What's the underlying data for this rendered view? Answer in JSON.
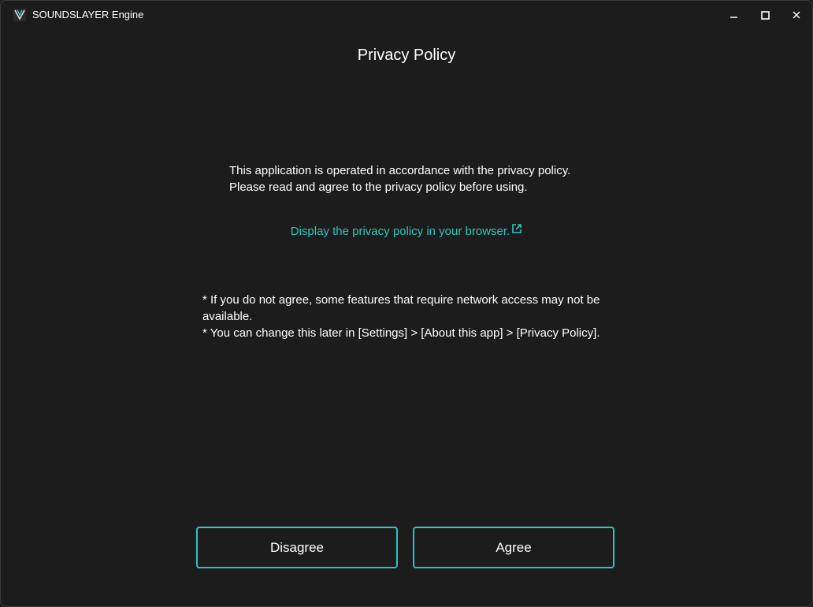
{
  "window": {
    "title": "SOUNDSLAYER Engine",
    "icon": "app-logo-icon",
    "controls": {
      "minimize": "minimize-icon",
      "maximize": "maximize-icon",
      "close": "close-icon"
    }
  },
  "dialog": {
    "heading": "Privacy Policy",
    "intro_line1": "This application is operated in accordance with the privacy policy.",
    "intro_line2": "Please read and agree to the privacy policy before using.",
    "link_text": "Display the privacy policy in your browser.",
    "link_icon": "external-link-icon",
    "note1": "* If you do not agree, some features that require network access may not be available.",
    "note2": "* You can change this later in [Settings] > [About this app] > [Privacy Policy].",
    "disagree_label": "Disagree",
    "agree_label": "Agree"
  },
  "colors": {
    "background": "#1c1c1c",
    "accent": "#2ec4bf",
    "text": "#ffffff"
  }
}
